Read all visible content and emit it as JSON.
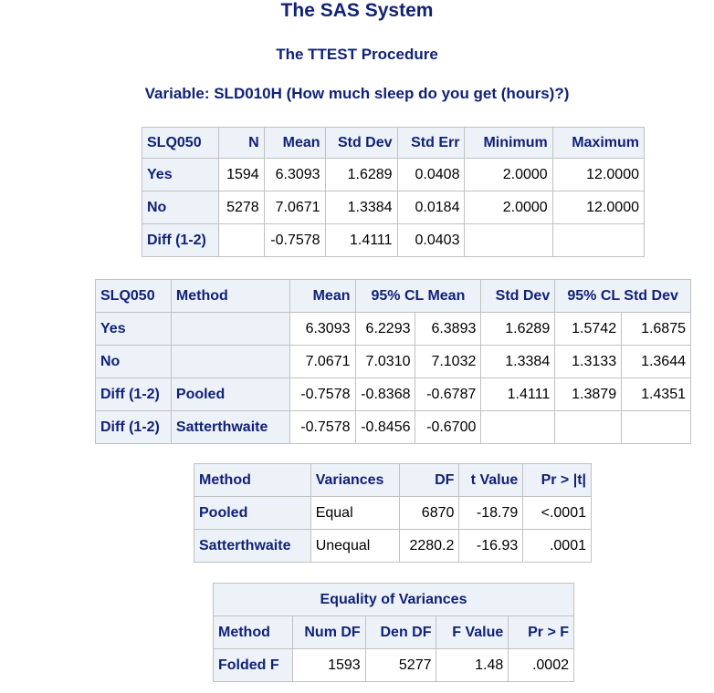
{
  "titles": {
    "system": "The SAS System",
    "procedure": "The TTEST Procedure",
    "variable": "Variable: SLD010H (How much sleep do you get (hours)?)"
  },
  "stats_table": {
    "headers": [
      "SLQ050",
      "N",
      "Mean",
      "Std Dev",
      "Std Err",
      "Minimum",
      "Maximum"
    ],
    "rows": [
      [
        "Yes",
        "1594",
        "6.3093",
        "1.6289",
        "0.0408",
        "2.0000",
        "12.0000"
      ],
      [
        "No",
        "5278",
        "7.0671",
        "1.3384",
        "0.0184",
        "2.0000",
        "12.0000"
      ],
      [
        "Diff (1-2)",
        "",
        "-0.7578",
        "1.4111",
        "0.0403",
        "",
        ""
      ]
    ]
  },
  "cl_table": {
    "headers": [
      "SLQ050",
      "Method",
      "Mean",
      "95% CL Mean",
      "Std Dev",
      "95% CL Std Dev"
    ],
    "rows": [
      [
        "Yes",
        "",
        "6.3093",
        "6.2293",
        "6.3893",
        "1.6289",
        "1.5742",
        "1.6875"
      ],
      [
        "No",
        "",
        "7.0671",
        "7.0310",
        "7.1032",
        "1.3384",
        "1.3133",
        "1.3644"
      ],
      [
        "Diff (1-2)",
        "Pooled",
        "-0.7578",
        "-0.8368",
        "-0.6787",
        "1.4111",
        "1.3879",
        "1.4351"
      ],
      [
        "Diff (1-2)",
        "Satterthwaite",
        "-0.7578",
        "-0.8456",
        "-0.6700",
        "",
        "",
        ""
      ]
    ]
  },
  "ttest_table": {
    "headers": [
      "Method",
      "Variances",
      "DF",
      "t Value",
      "Pr > |t|"
    ],
    "rows": [
      [
        "Pooled",
        "Equal",
        "6870",
        "-18.79",
        "<.0001"
      ],
      [
        "Satterthwaite",
        "Unequal",
        "2280.2",
        "-16.93",
        ".0001"
      ]
    ]
  },
  "eqvar_table": {
    "caption": "Equality of Variances",
    "headers": [
      "Method",
      "Num DF",
      "Den DF",
      "F Value",
      "Pr > F"
    ],
    "rows": [
      [
        "Folded F",
        "1593",
        "5277",
        "1.48",
        ".0002"
      ]
    ]
  }
}
